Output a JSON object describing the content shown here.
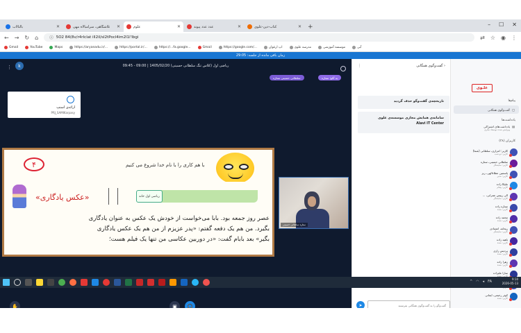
{
  "browser": {
    "tabs": [
      {
        "label": "بالتالاب",
        "color": "#1a73e8"
      },
      {
        "label": "ثلاشگاهی، سرامبالاه مهی",
        "color": "#e53935"
      },
      {
        "label": "علوم",
        "color": "#e53935"
      },
      {
        "label": "عدد عدد پیوند",
        "color": "#e53935"
      },
      {
        "label": "کتاب-دین-علوی",
        "color": "#ef6c00"
      },
      {
        "label": "برنامه سبز من",
        "color": "#43a047"
      }
    ],
    "address": "5O2 84(8v/r4rIclat ill2iI/sI2tPocl4im2l1l'Ibgi",
    "bookmarks": [
      "Gmail",
      "YouTube",
      "Maps",
      "https://aryanadu.ir/...",
      "https://portal.ir/...",
      "https://...fa.google...",
      "Gmail",
      "https://google.com/...",
      "اپ ارغوان",
      "مدرسه علوی",
      "موسسه آموزشی",
      "آبی"
    ]
  },
  "session": {
    "timer_text": "زمان باقی مانده از جلسه: 29:05"
  },
  "main": {
    "header_text": "ریاضی اول (کلاس تنگ سلطانی حسینی)   1405/02/20 | 09:00 - 09:45",
    "pill_a": "سلطانی حسینی ستاره",
    "pill_b": "به گلو؛ ستاره",
    "avatar_letter": "k",
    "share_title": "ارائه‌ی اسنپ",
    "share_sub": "PRJ_SAMIKarpasy",
    "slide": {
      "number": "۴",
      "top_line": "با هم کاری را با نام خدا شروع می کنیم",
      "tag": "ریاضی اول خانه",
      "subtitle": "«عکس یادگاری»",
      "lines": [
        "عصر روز جمعه بود. بابا می‌خواست از خودش یک عکس به عنوان یادگاری",
        "بگیرد. من هم یک دفعه گفتم: «پدر عزیزم از من هم یک عکس یادگاری",
        "بگیر» بعد بابام گفت: «در دوربین عکاسی من تنها یک فیلم هست؛"
      ]
    },
    "camera_name": "ستاره سلطانی حسینی"
  },
  "chat": {
    "title": "گفت‌وگوی همگانی",
    "msg1": "تاریخچه‌ی گفت‌وگو حذف گردید",
    "msg2a": "سامانه‌ی همایش مجازی موسسه‌ی علوی",
    "msg2b": "Alavi IT Center",
    "input_placeholder": "گفت‌وگو را به گفت‌وگوی همگانی بفرستید"
  },
  "users": {
    "logo": "علـوی",
    "section_messages": "پیام‌ها",
    "nav_public_chat": "گفت‌وگوی همگانی",
    "section_notes": "یادداشت‌ها",
    "nav_shared_notes": "یادداشت‌های اشتراکی",
    "nav_shared_notes_sub": "ویرایش شده توسط دیگری",
    "section_users": "کاربران (۳۸)",
    "list": [
      {
        "name": "کاربر: اعزاری، سلطانی (شما)",
        "status": "کاربر: دو شب"
      },
      {
        "name": "سلطانی حسینی، ستاره",
        "status": "کاربر: نمایشگر"
      },
      {
        "name": "یاسمین عطاءالهی، ریز",
        "status": "کاربر: مدیر"
      },
      {
        "name": "ملیکا زاده",
        "status": "کاربر: پیغام"
      },
      {
        "name": "الی رییس عمرانی، ...",
        "status": "کاربر: نمایشگر"
      },
      {
        "name": "ستاره زاده",
        "status": "کاربر: شده"
      },
      {
        "name": "محمد زاده",
        "status": "کاربر: شده"
      },
      {
        "name": "ریحانه، اعتمادی",
        "status": "کاربر: نمایشگر"
      },
      {
        "name": "ناهید زاده",
        "status": "کاربر: شده"
      },
      {
        "name": "پردیس رازی",
        "status": "کاربر: شده"
      },
      {
        "name": "زهرا زاده",
        "status": "کاربر: شده"
      },
      {
        "name": "سارا علیزاده",
        "status": "کاربر: شده"
      },
      {
        "name": "حسن رستگار",
        "status": "کاربر: شده"
      },
      {
        "name": "کوثر رحیمی، ایمانی",
        "status": "کاربر: شده"
      }
    ]
  },
  "taskbar": {
    "time": "9:10",
    "date": "2026-05-13"
  }
}
